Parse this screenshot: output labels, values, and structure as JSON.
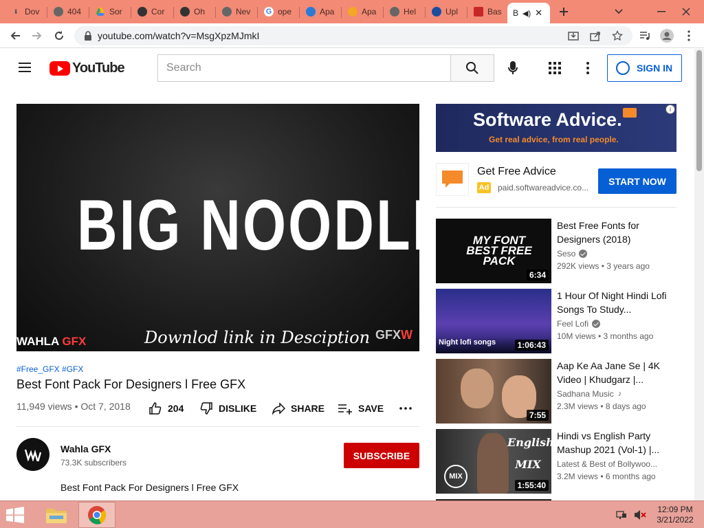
{
  "browser": {
    "tabs": [
      {
        "label": "Dov",
        "icon": "download-icon"
      },
      {
        "label": "404",
        "icon": "globe-icon"
      },
      {
        "label": "Sor",
        "icon": "drive-icon"
      },
      {
        "label": "Cor",
        "icon": "github-icon"
      },
      {
        "label": "Oh",
        "icon": "github-icon"
      },
      {
        "label": "Nev",
        "icon": "globe-icon"
      },
      {
        "label": "ope",
        "icon": "google-icon"
      },
      {
        "label": "Apa",
        "icon": "apache-icon"
      },
      {
        "label": "Apa",
        "icon": "apache-icon"
      },
      {
        "label": "Hel",
        "icon": "globe-icon"
      },
      {
        "label": "Upl",
        "icon": "upload-icon"
      },
      {
        "label": "Bas",
        "icon": "bookmark-icon"
      },
      {
        "label": "B",
        "icon": "youtube-icon",
        "active": true
      }
    ],
    "url": "youtube.com/watch?v=MsgXpzMJmkI"
  },
  "youtube": {
    "logo_text": "YouTube",
    "search_placeholder": "Search",
    "sign_in": "SIGN IN"
  },
  "video": {
    "overlay_title": "BIG NOODLE",
    "overlay_download": "Downlod link in Desciption",
    "overlay_brand_white": "WAHLA ",
    "overlay_brand_red": "GFX",
    "overlay_corner_white": "GFX",
    "overlay_corner_red": "W",
    "hashtags": "#Free_GFX #GFX",
    "title": "Best Font Pack For Designers l Free GFX",
    "meta": "11,949 views • Oct 7, 2018",
    "likes": "204",
    "dislike_label": "DISLIKE",
    "share_label": "SHARE",
    "save_label": "SAVE"
  },
  "channel": {
    "name": "Wahla GFX",
    "subscribers": "73.3K subscribers",
    "subscribe_label": "SUBSCRIBE",
    "description": "Best Font Pack For Designers l Free GFX"
  },
  "ad": {
    "banner_headline": "Software Advice.",
    "banner_sub": "Get real advice, from real people.",
    "title": "Get Free Advice",
    "badge": "Ad",
    "url": "paid.softwareadvice.co...",
    "cta": "START NOW"
  },
  "recommendations": [
    {
      "title": "Best Free Fonts for Designers (2018)",
      "channel": "Seso",
      "verified": true,
      "music": false,
      "meta": "292K views • 3 years ago",
      "duration": "6:34",
      "thumb_text": "MY FONT BEST FREE PACK"
    },
    {
      "title": "1 Hour Of Night Hindi Lofi Songs To Study...",
      "channel": "Feel Lofi",
      "verified": true,
      "music": false,
      "meta": "10M views • 3 months ago",
      "duration": "1:06:43",
      "thumb_text": "Night lofi songs"
    },
    {
      "title": "Aap Ke Aa Jane Se | 4K Video | Khudgarz |...",
      "channel": "Sadhana Music",
      "verified": false,
      "music": true,
      "meta": "2.3M views • 8 days ago",
      "duration": "7:55",
      "thumb_text": ""
    },
    {
      "title": "Hindi vs English Party Mashup 2021 (Vol-1) |...",
      "channel": "Latest & Best of Bollywoo...",
      "verified": false,
      "music": false,
      "meta": "3.2M views • 6 months ago",
      "duration": "1:55:40",
      "thumb_text": "English MIX"
    }
  ],
  "taskbar": {
    "time": "12:09 PM",
    "date": "3/21/2022"
  },
  "colors": {
    "tab_strip": "#f28a76",
    "youtube_red": "#ff0000",
    "subscribe_red": "#cc0000",
    "link_blue": "#065fd4",
    "taskbar": "#e8a29a"
  }
}
